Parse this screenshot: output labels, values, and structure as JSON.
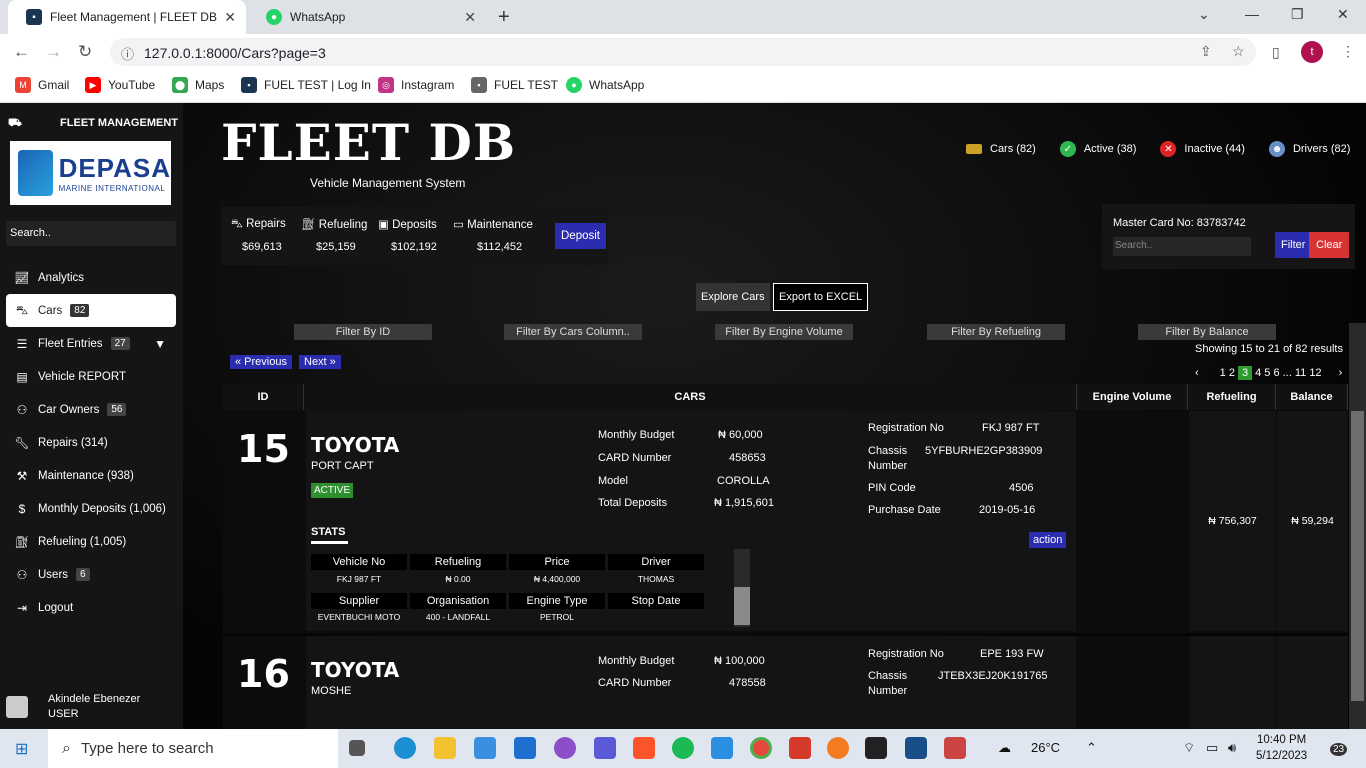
{
  "browser": {
    "tabs": [
      {
        "title": "Fleet Management | FLEET DB",
        "icon": "fleet-favicon"
      },
      {
        "title": "WhatsApp",
        "icon": "whatsapp-icon"
      }
    ],
    "url": "127.0.0.1:8000/Cars?page=3",
    "profile_initial": "t",
    "bookmarks": [
      {
        "label": "Gmail",
        "icon": "gmail-icon",
        "color": "#ea4335"
      },
      {
        "label": "YouTube",
        "icon": "youtube-icon",
        "color": "#ff0000"
      },
      {
        "label": "Maps",
        "icon": "maps-icon",
        "color": "#34a853"
      },
      {
        "label": "FUEL TEST | Log In",
        "icon": "fuel-test-icon",
        "color": "#1a3550"
      },
      {
        "label": "Instagram",
        "icon": "instagram-icon",
        "color": "#c13584"
      },
      {
        "label": "FUEL TEST",
        "icon": "fuel-test-icon",
        "color": "#666666"
      },
      {
        "label": "WhatsApp",
        "icon": "whatsapp-icon",
        "color": "#25d366"
      }
    ]
  },
  "sidebar": {
    "brand": "FLEET MANAGEMENT",
    "logo_text": "DEPASA",
    "logo_sub": "MARINE INTERNATIONAL",
    "search_placeholder": "Search..",
    "items": [
      {
        "label": "Analytics",
        "icon": "chart-icon",
        "badge": ""
      },
      {
        "label": "Cars",
        "icon": "car-icon",
        "badge": "82",
        "active": true
      },
      {
        "label": "Fleet Entries",
        "icon": "list-icon",
        "badge": "27",
        "caret": true
      },
      {
        "label": "Vehicle REPORT",
        "icon": "report-icon",
        "badge": ""
      },
      {
        "label": "Car Owners",
        "icon": "person-icon",
        "badge": "56"
      },
      {
        "label": "Repairs (314)",
        "icon": "wrench-icon",
        "badge": ""
      },
      {
        "label": "Maintenance (938)",
        "icon": "tools-icon",
        "badge": ""
      },
      {
        "label": "Monthly Deposits (1,006)",
        "icon": "dollar-icon",
        "badge": ""
      },
      {
        "label": "Refueling (1,005)",
        "icon": "fuel-icon",
        "badge": ""
      },
      {
        "label": "Users",
        "icon": "user-icon",
        "badge": "6"
      },
      {
        "label": "Logout",
        "icon": "logout-icon",
        "badge": ""
      }
    ],
    "user_name": "Akindele Ebenezer",
    "user_role": "USER"
  },
  "header": {
    "title": "FLEET DB",
    "subtitle": "Vehicle Management System",
    "stats": [
      {
        "label": "Cars (82)",
        "icon": "gold-bar-icon",
        "color": "#c9a227"
      },
      {
        "label": "Active (38)",
        "icon": "check-icon",
        "color": "#2fb84f"
      },
      {
        "label": "Inactive (44)",
        "icon": "cross-icon",
        "color": "#e02424"
      },
      {
        "label": "Drivers (82)",
        "icon": "driver-icon",
        "color": "#6a8fc4"
      }
    ]
  },
  "totals": {
    "items": [
      {
        "label": "Repairs",
        "value": "$69,613",
        "icon": "car-icon"
      },
      {
        "label": "Refueling",
        "value": "$25,159",
        "icon": "fuel-icon"
      },
      {
        "label": "Deposits",
        "value": "$102,192",
        "icon": "deposit-icon"
      },
      {
        "label": "Maintenance",
        "value": "$112,452",
        "icon": "card-icon"
      }
    ],
    "deposit_button": "Deposit"
  },
  "master_card": {
    "label": "Master Card No: 83783742",
    "search_placeholder": "Search..",
    "filter_button": "Filter",
    "clear_button": "Clear"
  },
  "actions": {
    "explore": "Explore Cars",
    "excel": "Export to EXCEL"
  },
  "filters": [
    "Filter By ID",
    "Filter By Cars Column..",
    "Filter By Engine Volume",
    "Filter By Refueling",
    "Filter By Balance"
  ],
  "pagination": {
    "previous": "« Previous",
    "next": "Next »",
    "showing": "Showing 15 to 21 of 82 results",
    "pages_before": "1 2",
    "current": "3",
    "pages_after": "4 5 6 ... 11 12"
  },
  "table": {
    "headers": [
      "ID",
      "CARS",
      "Engine Volume",
      "Refueling",
      "Balance"
    ],
    "rows": [
      {
        "id": "15",
        "make": "TOYOTA",
        "owner": "PORT CAPT",
        "status": "ACTIVE",
        "monthly_budget": "₦ 60,000",
        "card_number": "458653",
        "model": "COROLLA",
        "total_deposits": "₦ 1,915,601",
        "registration_no": "FKJ 987 FT",
        "chassis_number": "5YFBURHE2GP383909",
        "pin_code": "4506",
        "purchase_date": "2019-05-16",
        "stats_label": "STATS",
        "stats_headers": [
          "Vehicle No",
          "Refueling",
          "Price",
          "Driver",
          "Supplier",
          "Organisation",
          "Engine Type",
          "Stop Date"
        ],
        "stats_values": [
          "FKJ 987 FT",
          "₦ 0.00",
          "₦ 4,400,000",
          "THOMAS",
          "EVENTBUCHI MOTO",
          "400 - LANDFALL",
          "PETROL",
          ""
        ],
        "action": "action",
        "engine_volume": "",
        "refueling": "₦ 756,307",
        "balance": "₦ 59,294"
      },
      {
        "id": "16",
        "make": "TOYOTA",
        "owner": "MOSHE",
        "monthly_budget": "₦ 100,000",
        "card_number": "478558",
        "registration_no": "EPE 193 FW",
        "chassis_number": "JTEBX3EJ20K191765"
      }
    ],
    "labels": {
      "monthly_budget": "Monthly Budget",
      "card_number": "CARD Number",
      "model": "Model",
      "total_deposits": "Total Deposits",
      "registration_no": "Registration No",
      "chassis": "Chassis",
      "number": "Number",
      "pin_code": "PIN Code",
      "purchase_date": "Purchase Date"
    }
  },
  "taskbar": {
    "search_placeholder": "Type here to search",
    "weather": "26°C",
    "time": "10:40 PM",
    "date": "5/12/2023",
    "notifications": "23"
  }
}
